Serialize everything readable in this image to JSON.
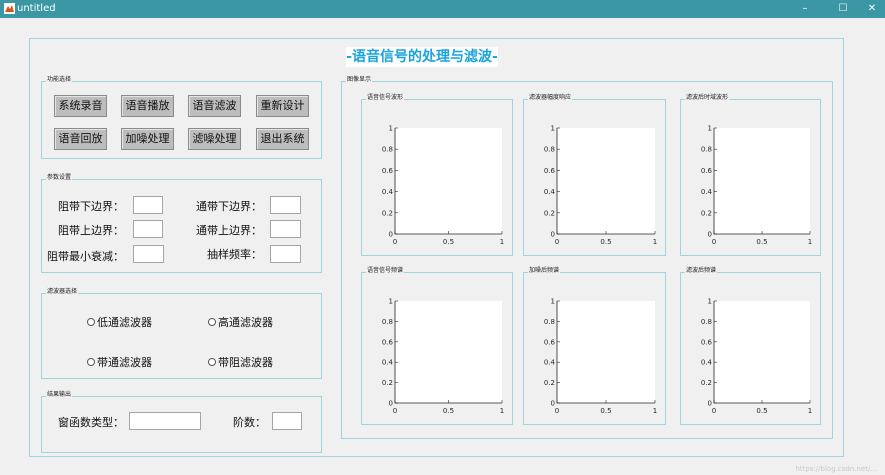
{
  "window": {
    "title": "untitled",
    "controls": {
      "minimize": "–",
      "maximize": "☐",
      "close": "✕"
    }
  },
  "main_title": "-语音信号的处理与滤波-",
  "function_group": {
    "label": "功能选择",
    "buttons": [
      "系统录音",
      "语音播放",
      "语音滤波",
      "重新设计",
      "语音回放",
      "加噪处理",
      "滤噪处理",
      "退出系统"
    ]
  },
  "params_group": {
    "label": "参数设置",
    "fields": [
      {
        "label": "阻带下边界：",
        "value": ""
      },
      {
        "label": "通带下边界：",
        "value": ""
      },
      {
        "label": "阻带上边界：",
        "value": ""
      },
      {
        "label": "通带上边界：",
        "value": ""
      },
      {
        "label": "阻带最小衰减：",
        "value": ""
      },
      {
        "label": "抽样频率：",
        "value": ""
      }
    ]
  },
  "filter_group": {
    "label": "滤波器选择",
    "options": [
      "低通滤波器",
      "高通滤波器",
      "带通滤波器",
      "带阻滤波器"
    ]
  },
  "result_group": {
    "label": "结果输出",
    "window_type_label": "窗函数类型：",
    "window_type_value": "",
    "order_label": "阶数：",
    "order_value": ""
  },
  "image_group": {
    "label": "图像显示"
  },
  "axes": [
    {
      "title": "语音信号波形"
    },
    {
      "title": "滤波器幅度响应"
    },
    {
      "title": "滤波后时域波形"
    },
    {
      "title": "语音信号频谱"
    },
    {
      "title": "加噪后频谱"
    },
    {
      "title": "滤波后频谱"
    }
  ],
  "chart_data": {
    "type": "line",
    "x_ticks": [
      "0",
      "0.5",
      "1"
    ],
    "y_ticks": [
      "0",
      "0.2",
      "0.4",
      "0.6",
      "0.8",
      "1"
    ],
    "xlim": [
      0,
      1
    ],
    "ylim": [
      0,
      1
    ],
    "series": []
  },
  "watermark": "https://blog.csdn.net/..."
}
